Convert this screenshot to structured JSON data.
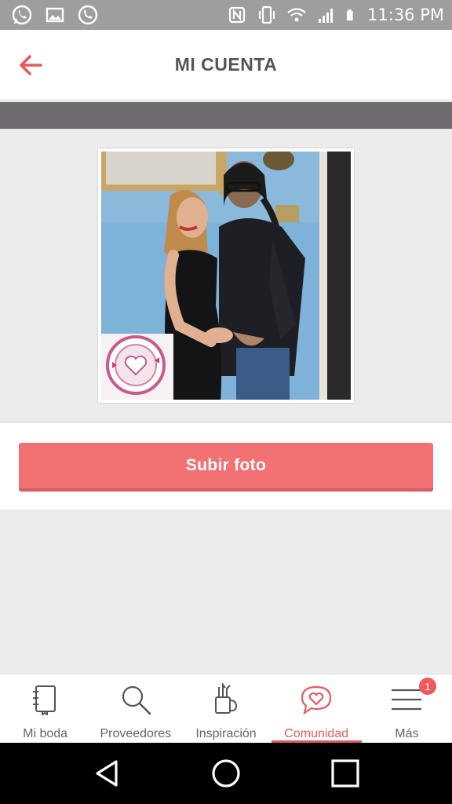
{
  "status_bar": {
    "time": "11:36 PM",
    "left_icons": [
      "whatsapp-icon",
      "image-icon",
      "phone-wifi-icon"
    ],
    "right_icons": [
      "nfc-icon",
      "vibrate-icon",
      "wifi-icon",
      "signal-icon",
      "battery-icon"
    ]
  },
  "header": {
    "title": "MI CUENTA",
    "back_icon": "arrow-left-icon"
  },
  "profile": {
    "upload_label": "Subir foto"
  },
  "bottom_nav": {
    "items": [
      {
        "label": "Mi boda",
        "icon": "notebook-icon"
      },
      {
        "label": "Proveedores",
        "icon": "search-icon"
      },
      {
        "label": "Inspiración",
        "icon": "brush-cup-icon"
      },
      {
        "label": "Comunidad",
        "icon": "heart-chat-icon",
        "active": true
      },
      {
        "label": "Más",
        "icon": "menu-icon",
        "badge": "1"
      }
    ]
  },
  "system_nav": [
    "back-triangle-icon",
    "home-circle-icon",
    "recents-square-icon"
  ],
  "colors": {
    "accent": "#f27173",
    "active_nav": "#e8595d",
    "header_title": "#555555",
    "dark_band": "#6f6b70"
  }
}
